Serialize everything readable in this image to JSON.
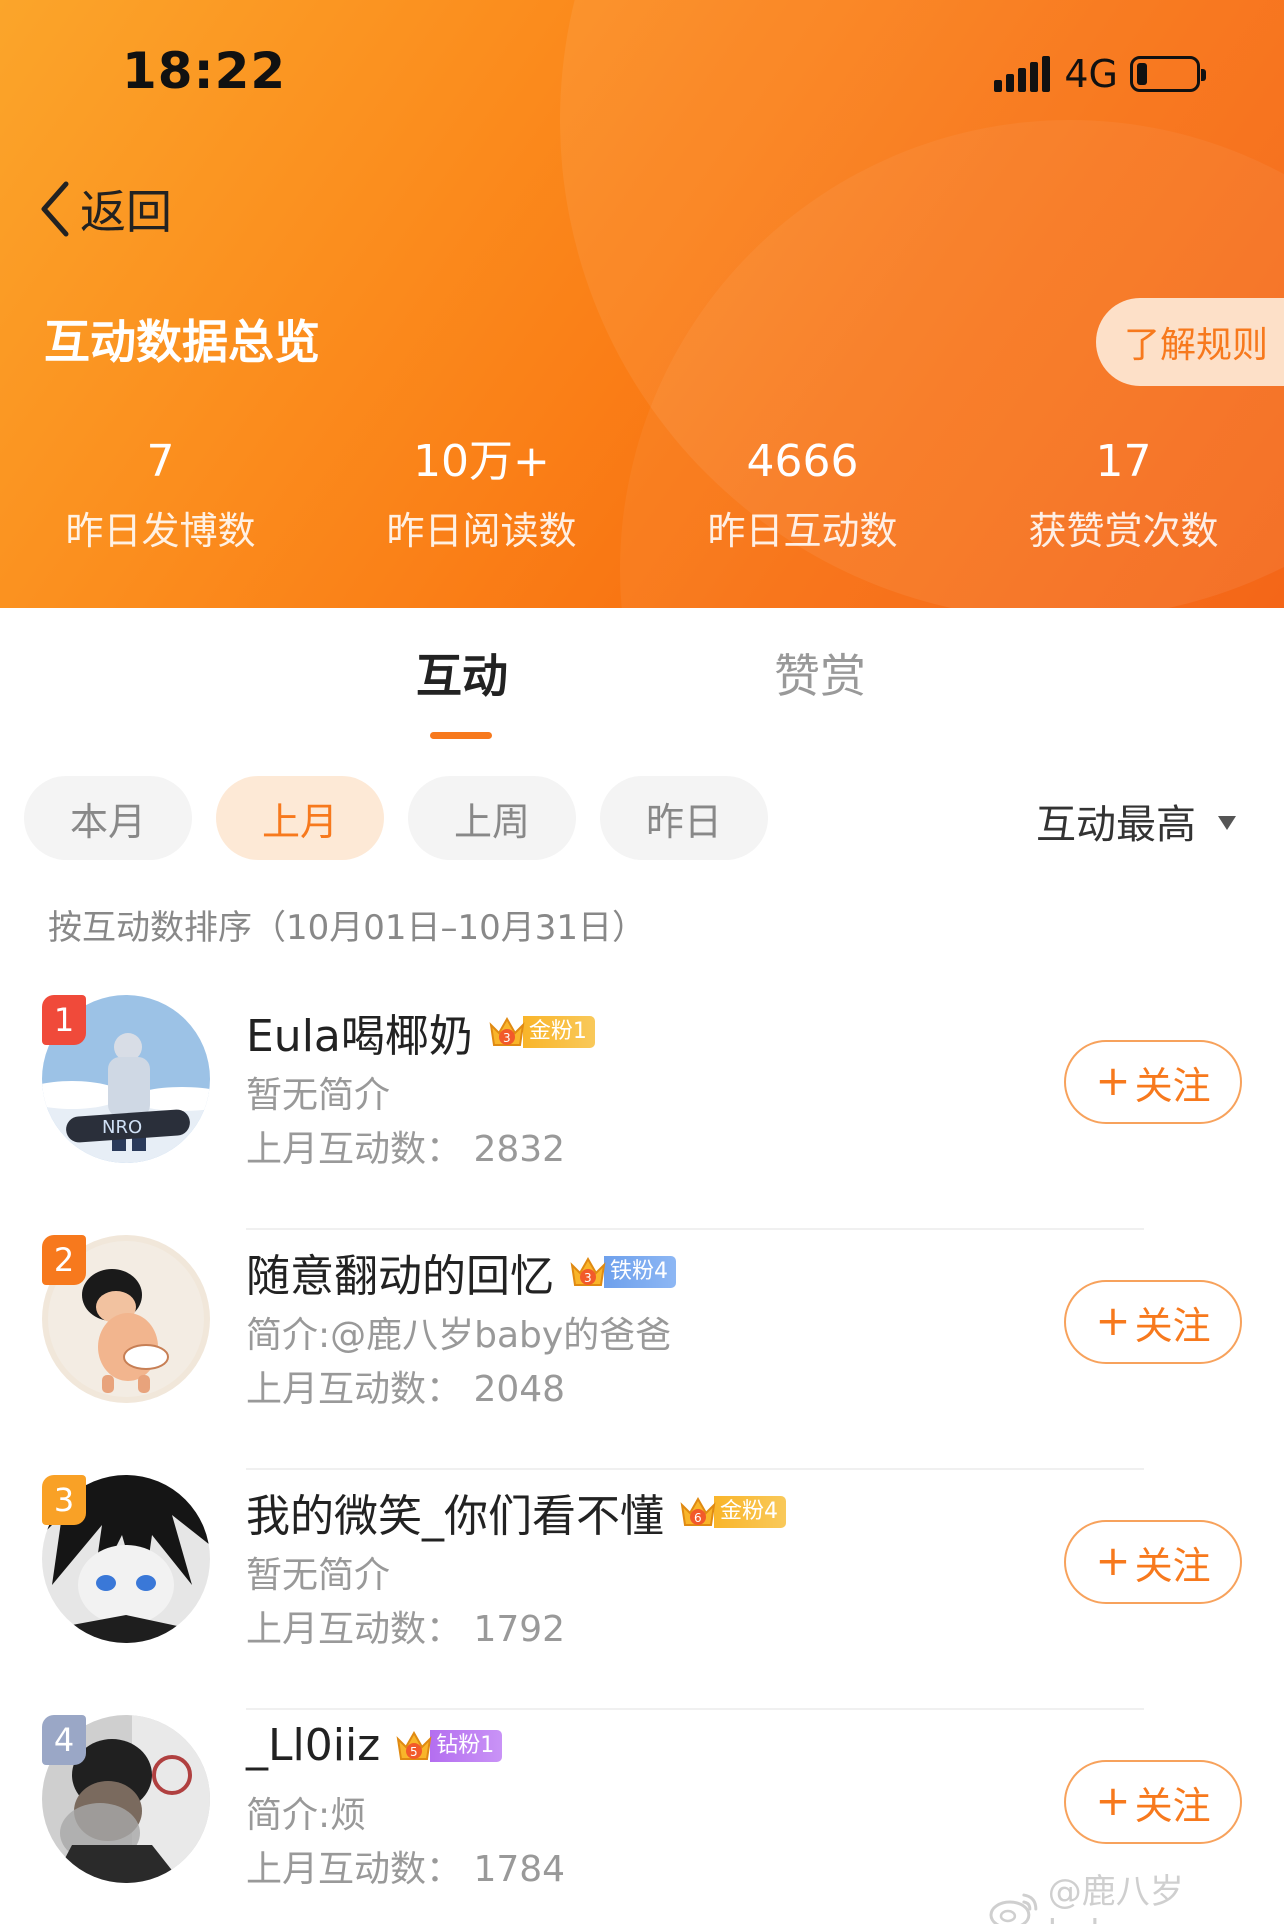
{
  "status_bar": {
    "time": "18:22",
    "network": "4G"
  },
  "nav": {
    "back_label": "返回"
  },
  "header": {
    "title": "互动数据总览",
    "rules_label": "了解规则",
    "stats": [
      {
        "value": "7",
        "label": "昨日发博数"
      },
      {
        "value": "10万+",
        "label": "昨日阅读数"
      },
      {
        "value": "4666",
        "label": "昨日互动数"
      },
      {
        "value": "17",
        "label": "获赞赏次数"
      }
    ]
  },
  "tabs": {
    "active": "互动",
    "inactive": "赞赏"
  },
  "filters": {
    "periods": [
      "本月",
      "上月",
      "上周",
      "昨日"
    ],
    "selected": "上月",
    "sort_label": "互动最高"
  },
  "sort_note": "按互动数排序（10月01日–10月31日）",
  "colors": {
    "accent": "#f7791d",
    "rank1": "#f04a3a",
    "rank2": "#f7791d",
    "rank3": "#f9a126",
    "rank4": "#9aa7c6"
  },
  "list": [
    {
      "rank": "1",
      "name": "Eula喝椰奶",
      "badge": "金粉1",
      "badge_level": "3",
      "bio": "暂无简介",
      "count": "上月互动数：  2832",
      "follow": "关注"
    },
    {
      "rank": "2",
      "name": "随意翻动的回忆",
      "badge": "铁粉4",
      "badge_level": "3",
      "bio": "简介:@鹿八岁baby的爸爸",
      "count": "上月互动数：  2048",
      "follow": "关注"
    },
    {
      "rank": "3",
      "name": "我的微笑_你们看不懂",
      "badge": "金粉4",
      "badge_level": "6",
      "bio": "暂无简介",
      "count": "上月互动数：  1792",
      "follow": "关注"
    },
    {
      "rank": "4",
      "name": "_Ll0iiz",
      "badge": "钻粉1",
      "badge_level": "5",
      "bio": "简介:烦",
      "count": "上月互动数：  1784",
      "follow": "关注"
    }
  ],
  "watermark": "@鹿八岁baby_"
}
